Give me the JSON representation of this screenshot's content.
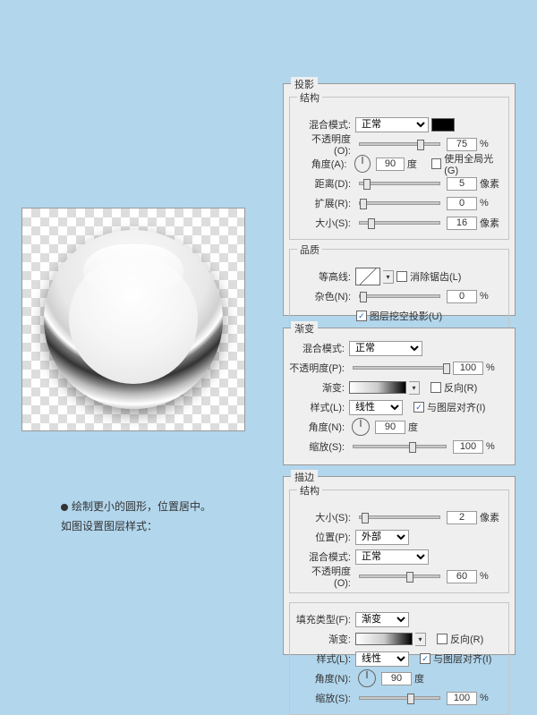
{
  "caption": {
    "line1": "绘制更小的圆形，位置居中。",
    "line2": "如图设置图层样式："
  },
  "shadow": {
    "title": "投影",
    "structure_label": "结构",
    "blend_label": "混合模式:",
    "blend_value": "正常",
    "opacity_label": "不透明度(O):",
    "opacity_value": "75",
    "opacity_unit": "%",
    "angle_label": "角度(A):",
    "angle_value": "90",
    "angle_unit": "度",
    "global_label": "使用全局光(G)",
    "distance_label": "距离(D):",
    "distance_value": "5",
    "distance_unit": "像素",
    "spread_label": "扩展(R):",
    "spread_value": "0",
    "spread_unit": "%",
    "size_label": "大小(S):",
    "size_value": "16",
    "size_unit": "像素",
    "quality_label": "品质",
    "contour_label": "等高线:",
    "antialias_label": "消除锯齿(L)",
    "noise_label": "杂色(N):",
    "noise_value": "0",
    "noise_unit": "%",
    "knockout_label": "图层挖空投影(U)"
  },
  "gradient": {
    "title": "渐变",
    "blend_label": "混合模式:",
    "blend_value": "正常",
    "opacity_label": "不透明度(P):",
    "opacity_value": "100",
    "opacity_unit": "%",
    "grad_label": "渐变:",
    "reverse_label": "反向(R)",
    "style_label": "样式(L):",
    "style_value": "线性",
    "align_label": "与图层对齐(I)",
    "angle_label": "角度(N):",
    "angle_value": "90",
    "angle_unit": "度",
    "scale_label": "缩放(S):",
    "scale_value": "100",
    "scale_unit": "%"
  },
  "stroke": {
    "title": "描边",
    "structure_label": "结构",
    "size_label": "大小(S):",
    "size_value": "2",
    "size_unit": "像素",
    "position_label": "位置(P):",
    "position_value": "外部",
    "blend_label": "混合模式:",
    "blend_value": "正常",
    "opacity_label": "不透明度(O):",
    "opacity_value": "60",
    "opacity_unit": "%",
    "filltype_label": "填充类型(F):",
    "filltype_value": "渐变",
    "grad_label": "渐变:",
    "reverse_label": "反向(R)",
    "style_label": "样式(L):",
    "style_value": "线性",
    "align_label": "与图层对齐(I)",
    "angle_label": "角度(N):",
    "angle_value": "90",
    "angle_unit": "度",
    "scale_label": "缩放(S):",
    "scale_value": "100",
    "scale_unit": "%"
  }
}
